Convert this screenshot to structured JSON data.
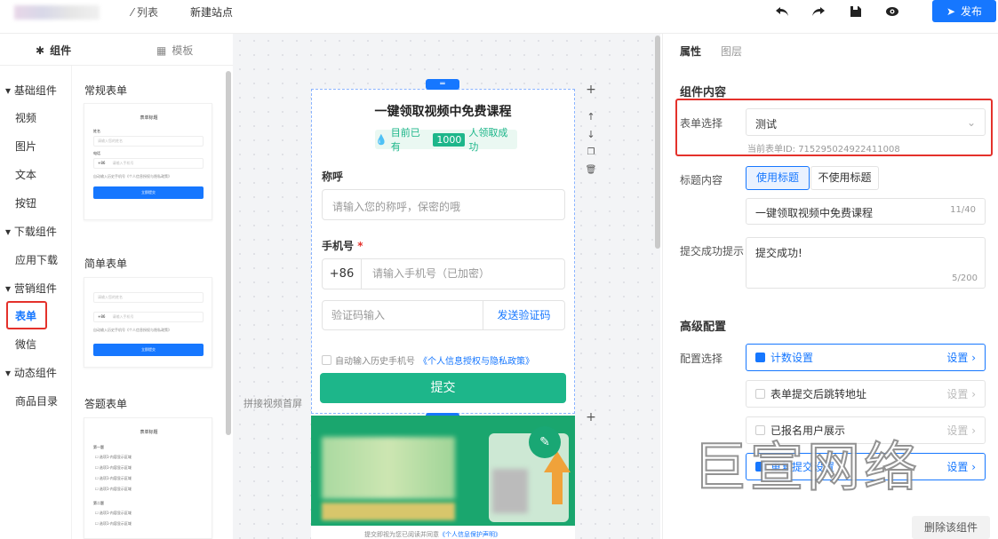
{
  "topbar": {
    "list_label": "列表",
    "site_title": "新建站点",
    "publish_label": "发布",
    "icons": [
      "undo-icon",
      "redo-icon",
      "save-icon",
      "preview-icon"
    ]
  },
  "left": {
    "tab_components": "组件",
    "tab_templates": "模板",
    "categories": [
      {
        "label": "基础组件",
        "items": [
          "视频",
          "图片",
          "文本",
          "按钮"
        ]
      },
      {
        "label": "下载组件",
        "items": [
          "应用下载"
        ]
      },
      {
        "label": "营销组件",
        "items": [
          "表单",
          "微信"
        ]
      },
      {
        "label": "动态组件",
        "items": [
          "商品目录"
        ]
      }
    ],
    "selected_item": "表单",
    "section_regular": "常规表单",
    "section_simple": "简单表单",
    "section_quiz": "答题表单"
  },
  "mini": {
    "form_title": "表单标题",
    "name": "姓名",
    "name_ph": "请输入您的姓名",
    "phone": "电话",
    "phone_prefix": "+86",
    "phone_ph": "请输入手机号",
    "verify_ph": "请输入验证码",
    "privacy": "自动输入历史手机号《个人信息授权与隐私政策》",
    "submit": "立即提交",
    "q1": "第一题",
    "q2": "第二题",
    "option": "选项1-内容显示区域"
  },
  "phone": {
    "title": "一键领取视频中免费课程",
    "count_prefix": "目前已有",
    "count": "1000",
    "count_suffix": "人领取成功",
    "name_label": "称呼",
    "name_ph": "请输入您的称呼，保密的哦",
    "phone_label": "手机号",
    "prefix": "+86",
    "phone_ph": "请输入手机号（已加密）",
    "code_ph": "验证码输入",
    "send_code": "发送验证码",
    "auto_fill": "自动输入历史手机号",
    "policy": "《个人信息授权与隐私政策》",
    "submit": "提交",
    "footer": "提交即视为您已阅读并同意",
    "footer_link": "《个人信息保护声明》",
    "canvas_label": "拼接视频首屏"
  },
  "right": {
    "tab_props": "属性",
    "tab_layers": "图层",
    "section_content": "组件内容",
    "form_select_label": "表单选择",
    "form_select_value": "测试",
    "form_id": "当前表单ID: 7152950249224110​08",
    "title_content_label": "标题内容",
    "use_title": "使用标题",
    "no_title": "不使用标题",
    "title_value": "一键领取视频中免费课程",
    "title_count": "11/40",
    "success_label": "提交成功提示",
    "success_value": "提交成功!",
    "success_count": "5/200",
    "section_advanced": "高级配置",
    "config_label": "配置选择",
    "configs": [
      {
        "label": "计数设置",
        "checked": true,
        "action": "设置"
      },
      {
        "label": "表单提交后跳转地址",
        "checked": false,
        "action": "设置"
      },
      {
        "label": "已报名用户展示",
        "checked": false,
        "action": "设置"
      },
      {
        "label": "重复提交设置",
        "checked": true,
        "action": "设置"
      }
    ],
    "delete": "删除该组件"
  },
  "watermark": "巨宣网络",
  "colors": {
    "primary": "#1677ff",
    "green": "#1db68a",
    "highlight": "#e4312b"
  }
}
